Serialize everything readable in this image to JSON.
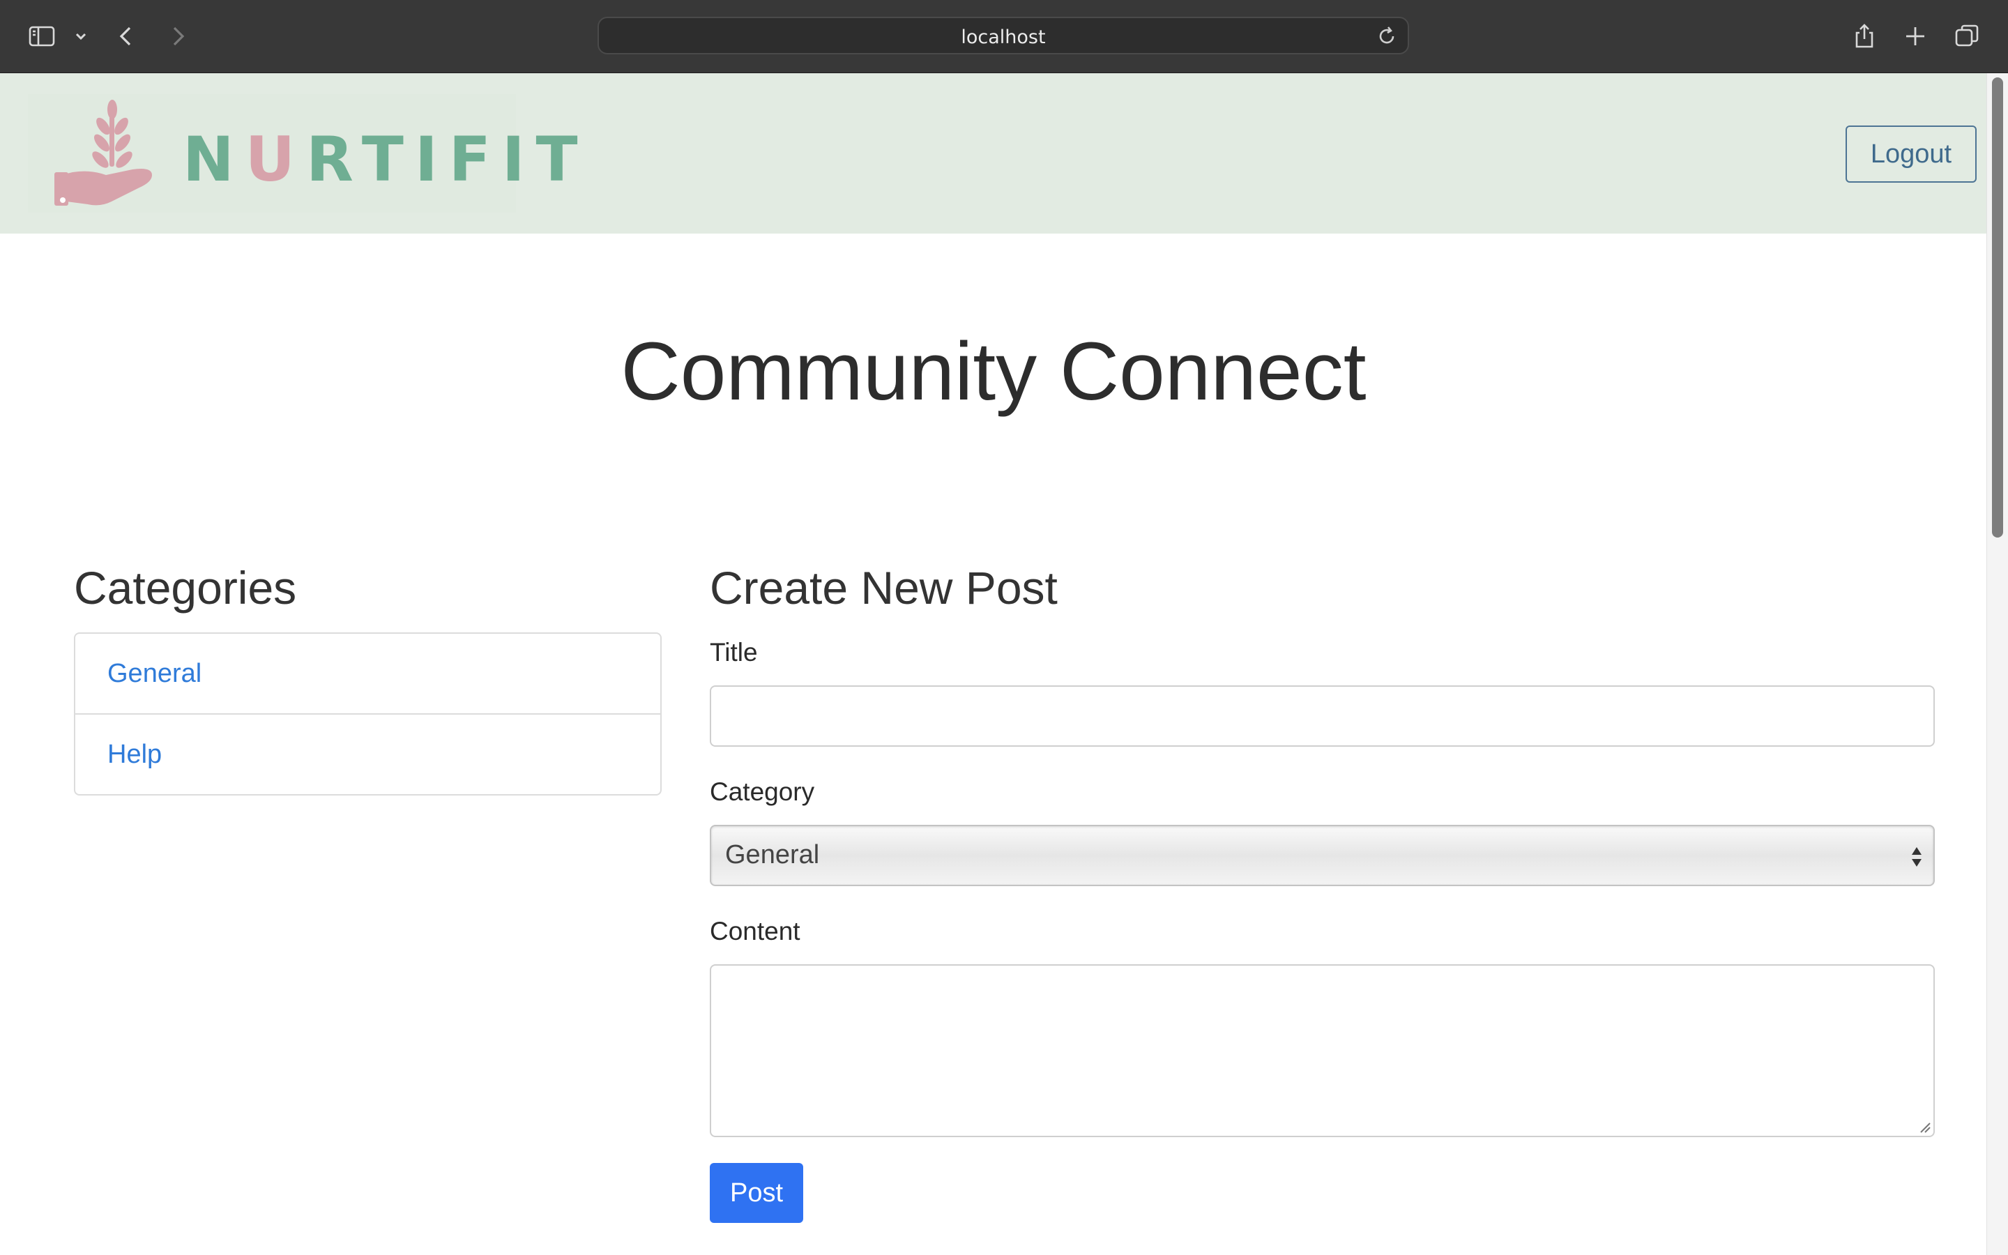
{
  "browser": {
    "url": "localhost",
    "icons": [
      "sidebar-icon",
      "chevron-down-icon",
      "back-icon",
      "forward-icon",
      "reload-icon",
      "share-icon",
      "new-tab-icon",
      "tabs-overview-icon"
    ]
  },
  "header": {
    "logo_text_before": "N",
    "logo_text_accent": "U",
    "logo_text_after": "RTIFIT",
    "logout_label": "Logout"
  },
  "page": {
    "title": "Community Connect"
  },
  "categories": {
    "heading": "Categories",
    "items": [
      {
        "label": "General"
      },
      {
        "label": "Help"
      }
    ]
  },
  "form": {
    "heading": "Create New Post",
    "title_label": "Title",
    "title_value": "",
    "category_label": "Category",
    "category_selected": "General",
    "content_label": "Content",
    "content_value": "",
    "submit_label": "Post"
  },
  "colors": {
    "header_bg": "#e2ebe2",
    "brand_green": "#6fae93",
    "brand_pink": "#d7a3ab",
    "link_blue": "#2f7bd9",
    "primary_button": "#2f72f2",
    "chrome_bg": "#383838"
  }
}
